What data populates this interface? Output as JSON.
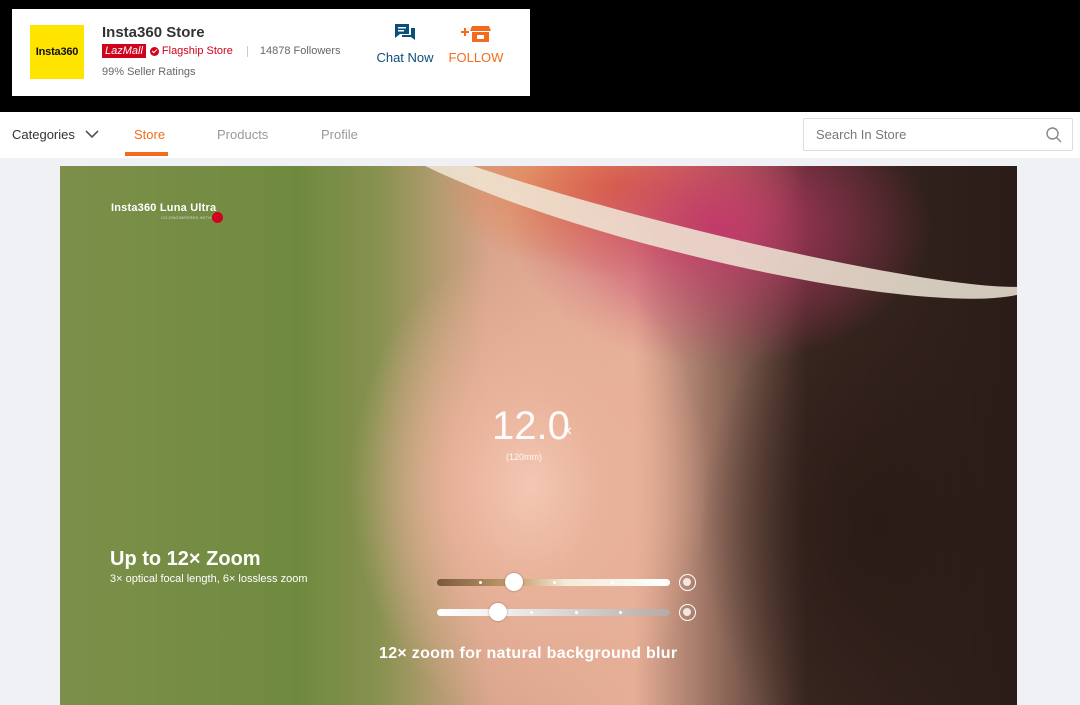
{
  "store": {
    "logo_text": "Insta360",
    "name": "Insta360 Store",
    "lazmall_badge": "LazMall",
    "flagship_label": "Flagship Store",
    "followers": "14878 Followers",
    "ratings": "99% Seller Ratings",
    "chat_label": "Chat Now",
    "follow_label": "FOLLOW"
  },
  "nav": {
    "categories_label": "Categories",
    "tabs": [
      {
        "label": "Store",
        "active": true
      },
      {
        "label": "Products",
        "active": false
      },
      {
        "label": "Profile",
        "active": false
      }
    ],
    "search_placeholder": "Search In Store"
  },
  "banner": {
    "brand_logo": "Insta360 Luna Ultra",
    "brand_sub": "CO-ENGINEERED WITH",
    "zoom_value": "12.0",
    "zoom_unit": "×",
    "focal_length": "(120mm)",
    "headline": "Up to 12× Zoom",
    "subline": "3× optical focal length, 6× lossless zoom",
    "caption": "12× zoom for natural background blur",
    "slider1_level": 0.33,
    "slider2_level": 0.26
  },
  "colors": {
    "accent": "#f36b1c",
    "lazmall_red": "#d0021b",
    "chat_blue": "#0a4f7a",
    "logo_yellow": "#ffe400"
  },
  "icons": [
    "chat-icon",
    "follow-store-icon",
    "chevron-down-icon",
    "search-icon",
    "check-icon",
    "leica-icon",
    "portrait-icon",
    "blur-icon"
  ]
}
